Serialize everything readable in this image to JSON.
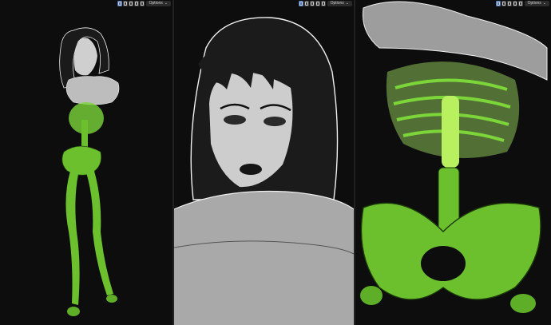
{
  "viewports": [
    {
      "id": "left",
      "options_label": "Options"
    },
    {
      "id": "middle",
      "options_label": "Options"
    },
    {
      "id": "right",
      "options_label": "Options"
    }
  ],
  "header_icons": [
    "select-box-icon",
    "select-extend-icon",
    "select-subtract-icon",
    "select-invert-icon",
    "select-intersect-icon"
  ],
  "colors": {
    "background": "#0d0d0d",
    "bone_green": "#7cd63a",
    "skin_gray": "#c8c8c8",
    "hair_black": "#1a1a1a",
    "options_bg": "#2b2b2b",
    "active_mode": "#4772b3"
  }
}
